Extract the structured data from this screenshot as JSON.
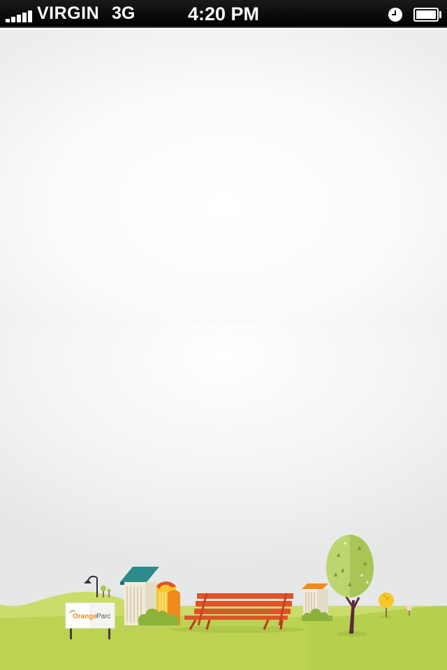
{
  "status_bar": {
    "carrier": "VIRGIN",
    "network": "3G",
    "time": "4:20 PM",
    "signal_bars": 5,
    "icons": [
      "signal-icon",
      "alarm-clock-icon",
      "battery-icon"
    ]
  },
  "scene": {
    "sign": {
      "brand_part1": "Orange",
      "brand_part2": "Parc"
    },
    "colors": {
      "grass": "#b8d24a",
      "grass_light": "#cadd6a",
      "bench": "#e0522a",
      "tree_foliage": "#b9d36a",
      "roof_teal": "#2d8a8a",
      "building_orange": "#f08a1e",
      "building_yellow": "#f7c62a"
    }
  }
}
